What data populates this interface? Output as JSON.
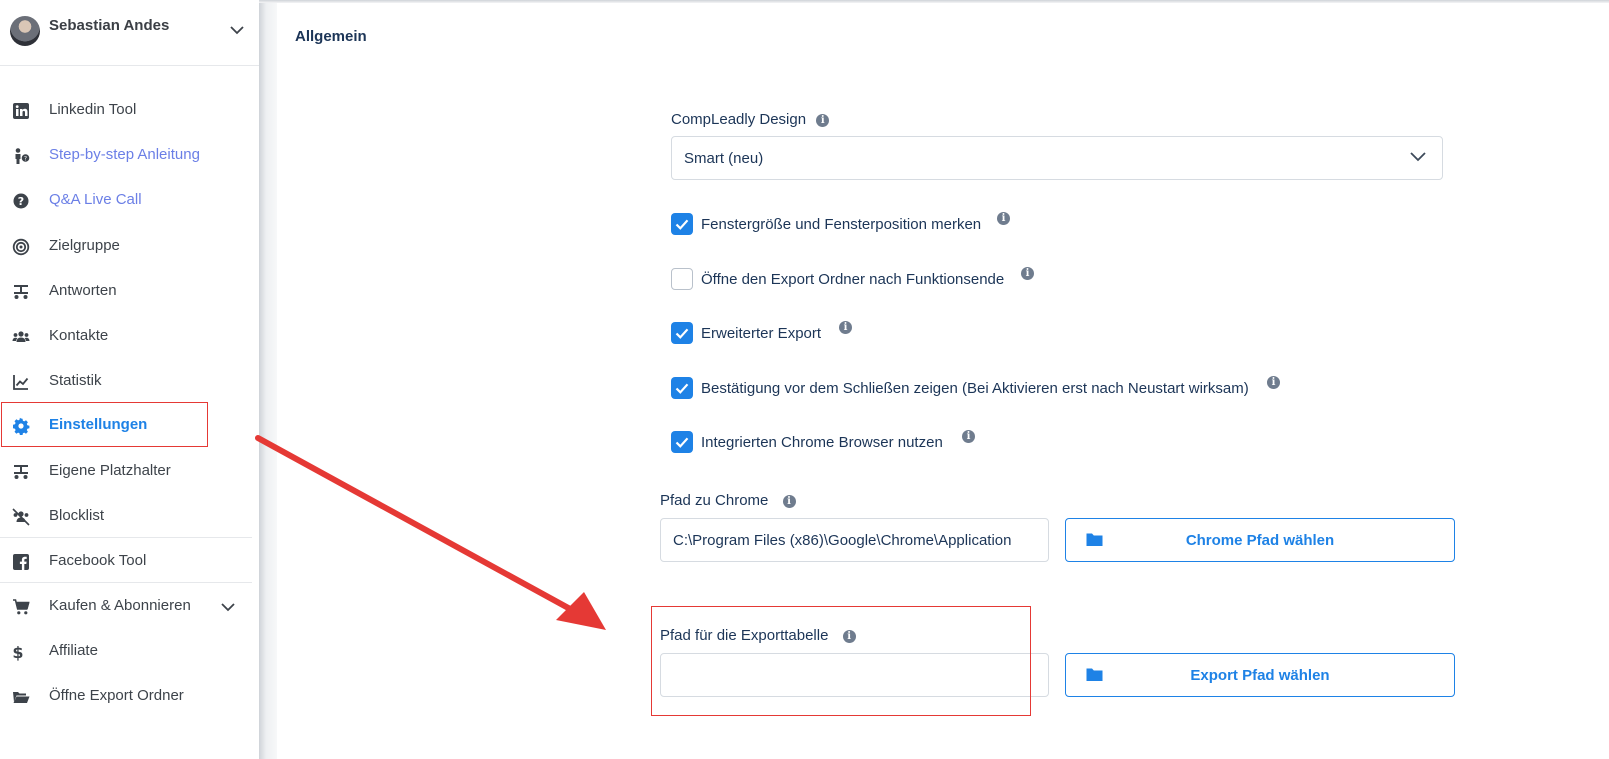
{
  "user": {
    "name": "Sebastian Andes"
  },
  "nav": [
    {
      "label": "Linkedin Tool",
      "icon": "linkedin-icon"
    },
    {
      "label": "Step-by-step Anleitung",
      "icon": "person-help-icon"
    },
    {
      "label": "Q&A Live Call",
      "icon": "question-circle-icon"
    },
    {
      "label": "Zielgruppe",
      "icon": "target-icon"
    },
    {
      "label": "Antworten",
      "icon": "reply-icon"
    },
    {
      "label": "Kontakte",
      "icon": "users-icon"
    },
    {
      "label": "Statistik",
      "icon": "chart-line-icon"
    },
    {
      "label": "Einstellungen",
      "icon": "gear-icon"
    },
    {
      "label": "Eigene Platzhalter",
      "icon": "placeholder-icon"
    },
    {
      "label": "Blocklist",
      "icon": "users-block-icon"
    },
    {
      "label": "Facebook Tool",
      "icon": "facebook-icon"
    },
    {
      "label": "Kaufen & Abonnieren",
      "icon": "cart-icon"
    },
    {
      "label": "Affiliate",
      "icon": "dollar-icon"
    },
    {
      "label": "Öffne Export Ordner",
      "icon": "folder-open-icon"
    }
  ],
  "settings": {
    "section_title": "Allgemein",
    "design_label": "CompLeadly Design",
    "design_value": "Smart (neu)",
    "checks": [
      {
        "label": "Fenstergröße und Fensterposition merken",
        "checked": true
      },
      {
        "label": "Öffne den Export Ordner nach Funktionsende",
        "checked": false
      },
      {
        "label": "Erweiterter Export",
        "checked": true
      },
      {
        "label": "Bestätigung vor dem Schließen zeigen (Bei Aktivieren erst nach Neustart wirksam)",
        "checked": true
      },
      {
        "label": "Integrierten Chrome Browser nutzen",
        "checked": true
      }
    ],
    "chrome_path_label": "Pfad zu Chrome",
    "chrome_path_value": "C:\\Program Files (x86)\\Google\\Chrome\\Application",
    "chrome_button": "Chrome Pfad wählen",
    "export_path_label": "Pfad für die Exporttabelle",
    "export_path_value": "",
    "export_button": "Export Pfad wählen"
  },
  "colors": {
    "accent": "#1e82e6",
    "annotation": "#e53935",
    "text": "#1c3557"
  }
}
